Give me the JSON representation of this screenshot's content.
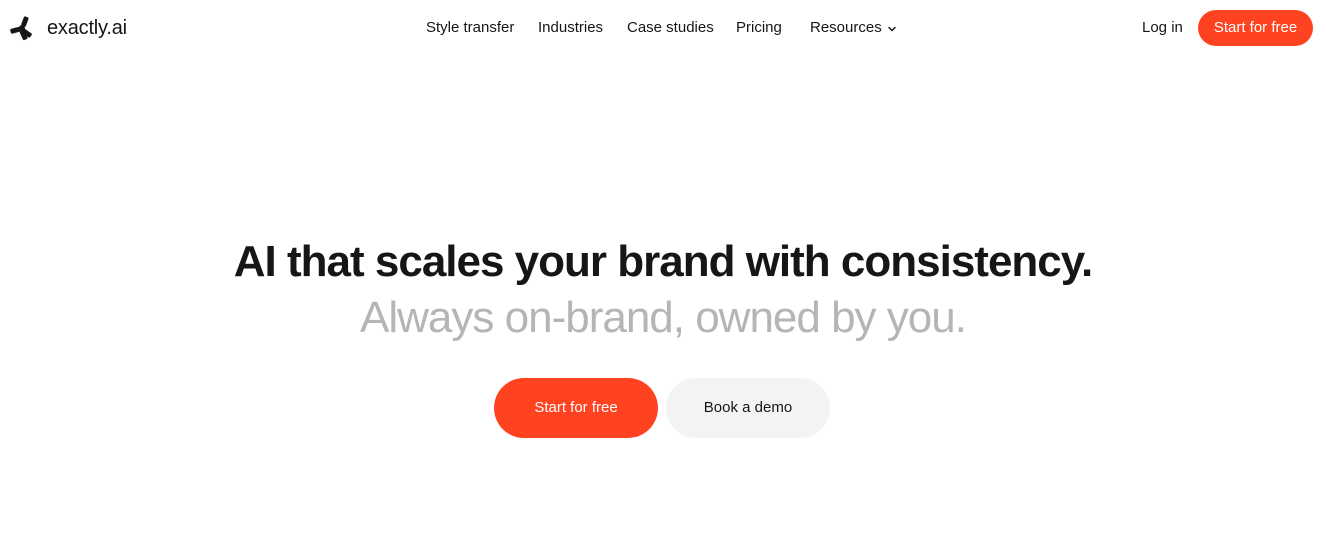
{
  "brand": {
    "name": "exactly.ai",
    "logo_icon": "asterisk-logo-icon",
    "accent_color": "#ff4220",
    "text_color": "#161616",
    "muted_text_color": "#b5b5b5",
    "secondary_button_color": "#f3f3f3"
  },
  "nav": {
    "items": [
      {
        "label": "Style transfer"
      },
      {
        "label": "Industries"
      },
      {
        "label": "Case studies"
      },
      {
        "label": "Pricing"
      },
      {
        "label": "Resources",
        "icon": "chevron-down-icon"
      }
    ],
    "login_label": "Log in",
    "cta_label": "Start for free"
  },
  "hero": {
    "title": "AI that scales your brand with consistency.",
    "subtitle": "Always on-brand, owned by you.",
    "primary_button_label": "Start for free",
    "secondary_button_label": "Book a demo"
  }
}
